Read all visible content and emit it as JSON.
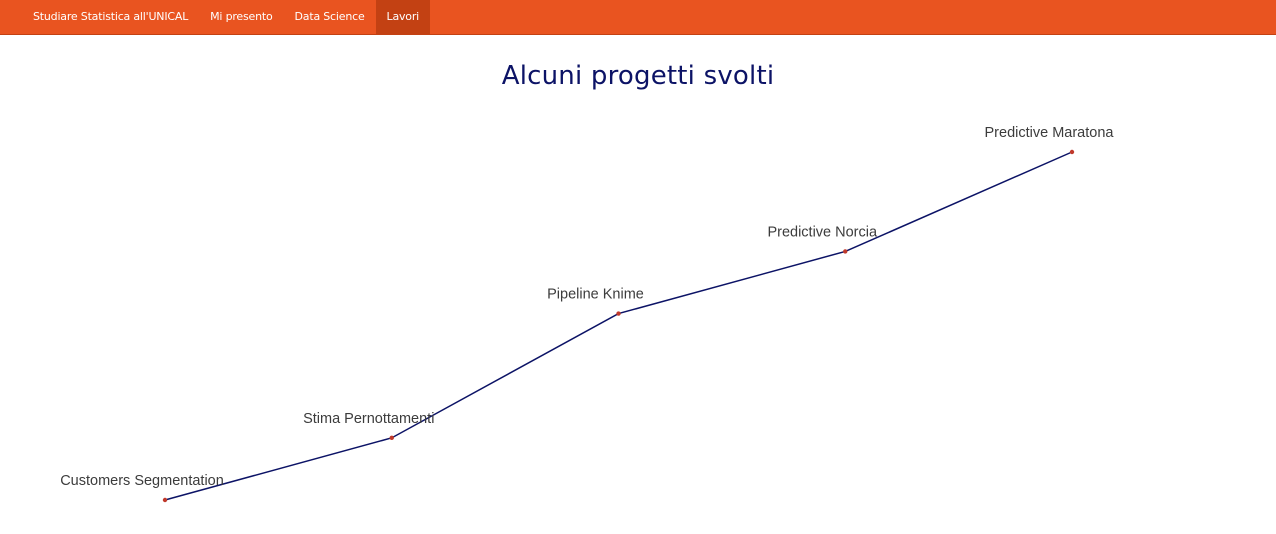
{
  "navbar": {
    "items": [
      {
        "label": "Studiare Statistica all'UNICAL",
        "active": false
      },
      {
        "label": "Mi presento",
        "active": false
      },
      {
        "label": "Data Science",
        "active": false
      },
      {
        "label": "Lavori",
        "active": true
      }
    ],
    "color": "#e95420",
    "active_color": "#c34113"
  },
  "page": {
    "title": "Alcuni progetti svolti"
  },
  "chart_data": {
    "type": "line",
    "categories": [
      "Customers Segmentation",
      "Stima Pernottamenti",
      "Pipeline Knime",
      "Predictive Norcia",
      "Predictive Maratona"
    ],
    "values": [
      1,
      2,
      4,
      5,
      6.6
    ],
    "point_labels": [
      "Customers Segmentation",
      "Stima Pernottamenti",
      "Pipeline Knime",
      "Predictive Norcia",
      "Predictive Maratona"
    ],
    "line_color": "#0c1366",
    "point_color": "#c0392b",
    "grid": false,
    "axes_visible": false
  }
}
